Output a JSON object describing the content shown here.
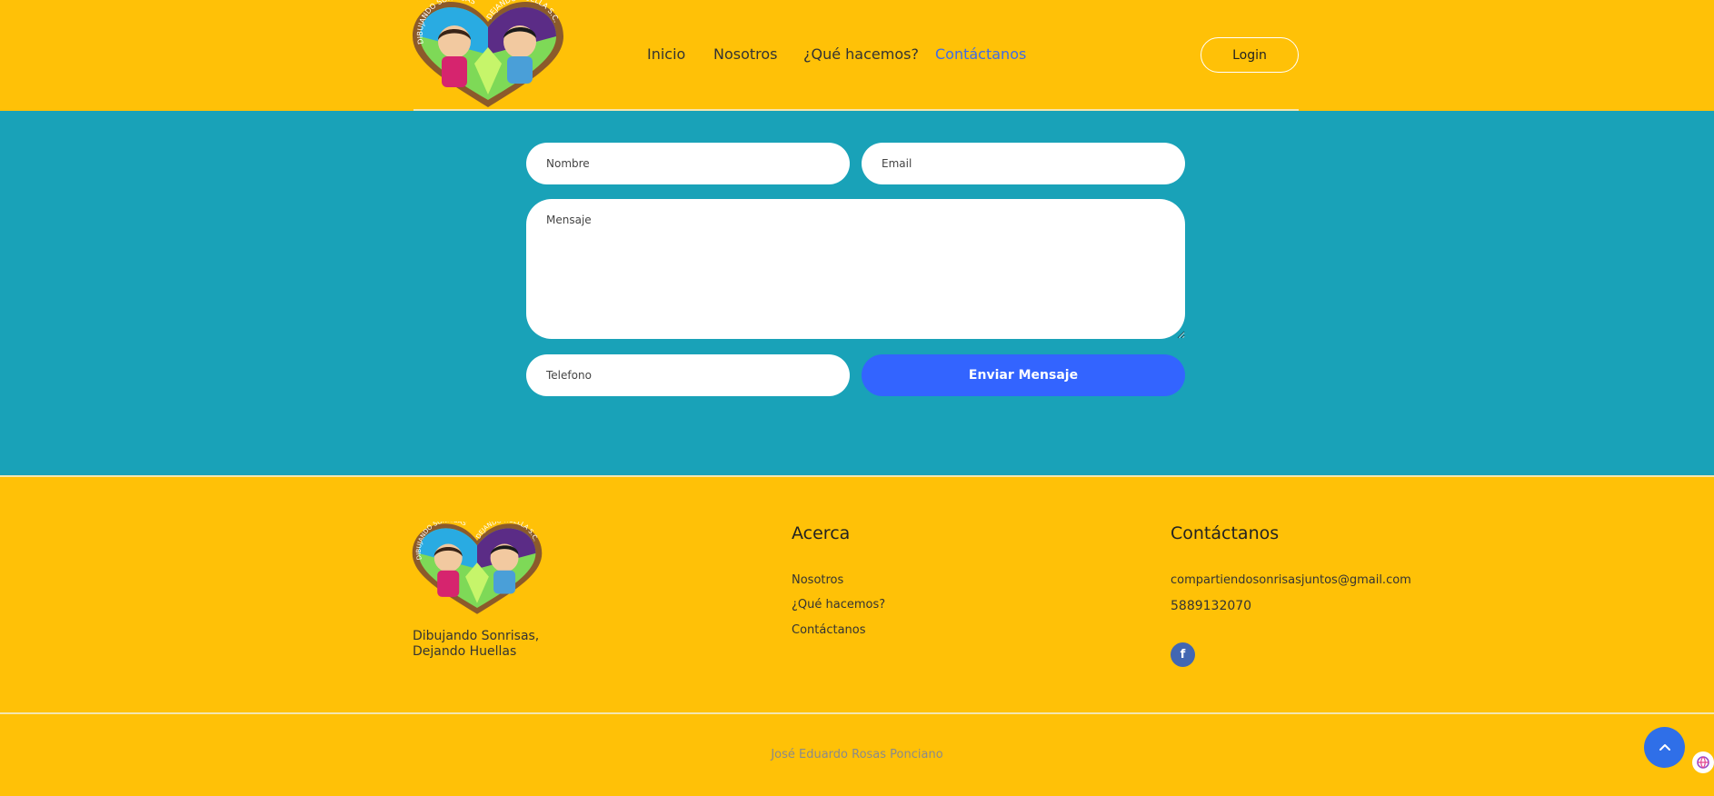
{
  "header": {
    "nav": [
      {
        "label": "Inicio"
      },
      {
        "label": "Nosotros"
      },
      {
        "label": "¿Qué hacemos?"
      },
      {
        "label": "Contáctanos",
        "active": true
      }
    ],
    "login_label": "Login"
  },
  "form": {
    "nombre_placeholder": "Nombre",
    "email_placeholder": "Email",
    "mensaje_placeholder": "Mensaje",
    "telefono_placeholder": "Telefono",
    "submit_label": "Enviar Mensaje"
  },
  "footer": {
    "tagline_line1": "Dibujando Sonrisas,",
    "tagline_line2": "Dejando Huellas",
    "about": {
      "title": "Acerca",
      "links": [
        "Nosotros",
        "¿Qué hacemos?",
        "Contáctanos"
      ]
    },
    "contact": {
      "title": "Contáctanos",
      "email": "compartiendosonrisasjuntos@gmail.com",
      "phone": "5889132070",
      "social_icon": "facebook-icon"
    },
    "copyright": "José Eduardo Rosas Ponciano"
  },
  "logo": {
    "text_left": "DIBUJANDO SONRISAS",
    "text_right": "DEJANDO HUELLA S.C."
  },
  "colors": {
    "header_bg": "#FFC107",
    "form_bg": "#19A2B8",
    "accent_blue": "#3364FF",
    "active_link": "#3E6BE8",
    "facebook": "#4267B2"
  }
}
